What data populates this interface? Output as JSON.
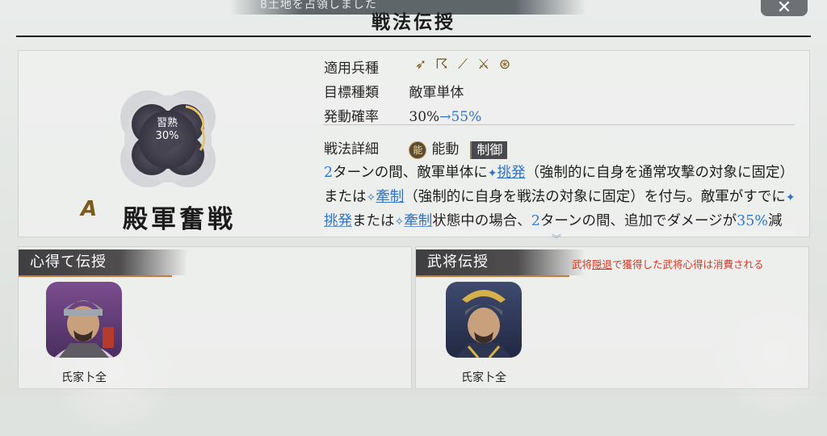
{
  "header": {
    "toast": "8土地を占領しました",
    "title": "戦法伝授",
    "close_label": "✕"
  },
  "skill": {
    "proficiency_label": "習熟",
    "proficiency_value": "30%",
    "rank": "A",
    "name": "殿軍奮戦",
    "unit_types_label": "適用兵種",
    "unit_type_icons": [
      "spear-icon",
      "bow-icon",
      "musket-icon",
      "sword-icon",
      "wheel-icon"
    ],
    "target_label": "目標種類",
    "target_value": "敵軍単体",
    "prob_label": "発動確率",
    "prob_base": "30%",
    "prob_arrow": "→",
    "prob_up": "55%",
    "detail_label": "戦法詳細",
    "ability_badge": "能",
    "ability_type": "能動",
    "category_tag": "制御",
    "description": {
      "turns": "2",
      "p1": "ターンの間、敵軍単体に",
      "kw_taunt": "挑発",
      "p2": "（強制的に自身を通常攻撃の対象に固定）または",
      "kw_restrain": "牽制",
      "p3": "（強制的に自身を戦法の対象に固定）を付与。敵軍がすでに",
      "p4": "または",
      "p5": "状態中の場合、",
      "turns2": "2",
      "p6": "ターンの間、追加でダメージが",
      "pct": "35%",
      "p7": "減少。二状態同時"
    }
  },
  "inherit_panel": {
    "header": "心得て伝授",
    "commander_name": "氏家卜全"
  },
  "general_panel": {
    "header": "武将伝授",
    "note_pre": "武将",
    "note_link": "隠退",
    "note_post": "で獲得した武将心得は消費される",
    "commander_name": "氏家卜全"
  },
  "colors": {
    "accent_blue": "#2f73c9",
    "note_red": "#cf3b2a",
    "gold": "#7b5a1c"
  }
}
